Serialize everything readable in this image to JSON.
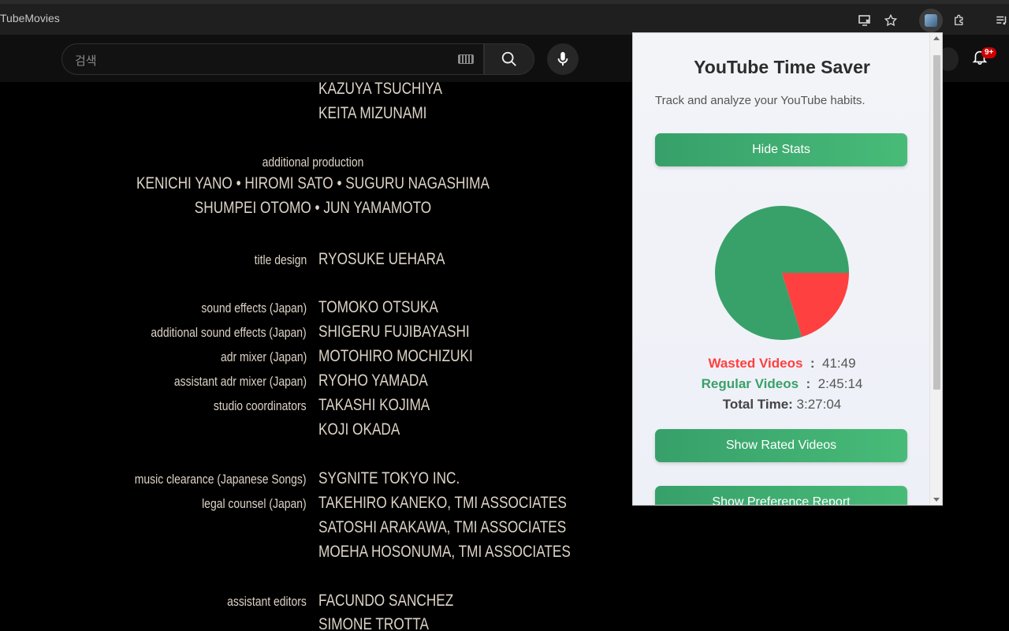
{
  "browser": {
    "tab_title": "TubeMovies",
    "icons": [
      "install-icon",
      "star-icon",
      "extension-avatar-icon",
      "puzzle-icon",
      "playlist-icon"
    ]
  },
  "youtube": {
    "search_placeholder": "검색",
    "notification_badge": "9+"
  },
  "credits": {
    "top_names": [
      "KAZUYA TSUCHIYA",
      "KEITA MIZUNAMI"
    ],
    "additional_production_label": "additional production",
    "additional_production_line1": "KENICHI YANO  •  HIROMI SATO  •  SUGURU NAGASHIMA",
    "additional_production_line2": "SHUMPEI OTOMO  •  JUN YAMAMOTO",
    "rows": [
      {
        "role": "title design",
        "name": "RYOSUKE UEHARA"
      },
      {
        "role": "sound effects (Japan)",
        "name": "TOMOKO OTSUKA"
      },
      {
        "role": "additional sound effects (Japan)",
        "name": "SHIGERU FUJIBAYASHI"
      },
      {
        "role": "adr mixer (Japan)",
        "name": "MOTOHIRO MOCHIZUKI"
      },
      {
        "role": "assistant adr mixer (Japan)",
        "name": "RYOHO YAMADA"
      },
      {
        "role": "studio coordinators",
        "name": "TAKASHI KOJIMA"
      },
      {
        "role": "",
        "name": "KOJI OKADA"
      },
      {
        "role": "music clearance (Japanese Songs)",
        "name": "SYGNITE TOKYO INC."
      },
      {
        "role": "legal counsel (Japan)",
        "name": "TAKEHIRO KANEKO, TMI ASSOCIATES"
      },
      {
        "role": "",
        "name": "SATOSHI ARAKAWA, TMI ASSOCIATES"
      },
      {
        "role": "",
        "name": "MOEHA HOSONUMA, TMI ASSOCIATES"
      },
      {
        "role": "assistant editors",
        "name": "FACUNDO SANCHEZ"
      },
      {
        "role": "",
        "name": "SIMONE TROTTA"
      }
    ]
  },
  "popup": {
    "title": "YouTube Time Saver",
    "subtitle": "Track and analyze your YouTube habits.",
    "hide_stats_label": "Hide Stats",
    "wasted_label": "Wasted Videos",
    "wasted_value": "41:49",
    "regular_label": "Regular Videos",
    "regular_value": "2:45:14",
    "total_label": "Total Time:",
    "total_value": "3:27:04",
    "show_rated_label": "Show Rated Videos",
    "show_preference_label": "Show Preference Report",
    "colors": {
      "wasted": "#ff4040",
      "regular": "#38a169"
    },
    "pie_fractions": {
      "wasted": 0.202,
      "regular": 0.798
    }
  }
}
